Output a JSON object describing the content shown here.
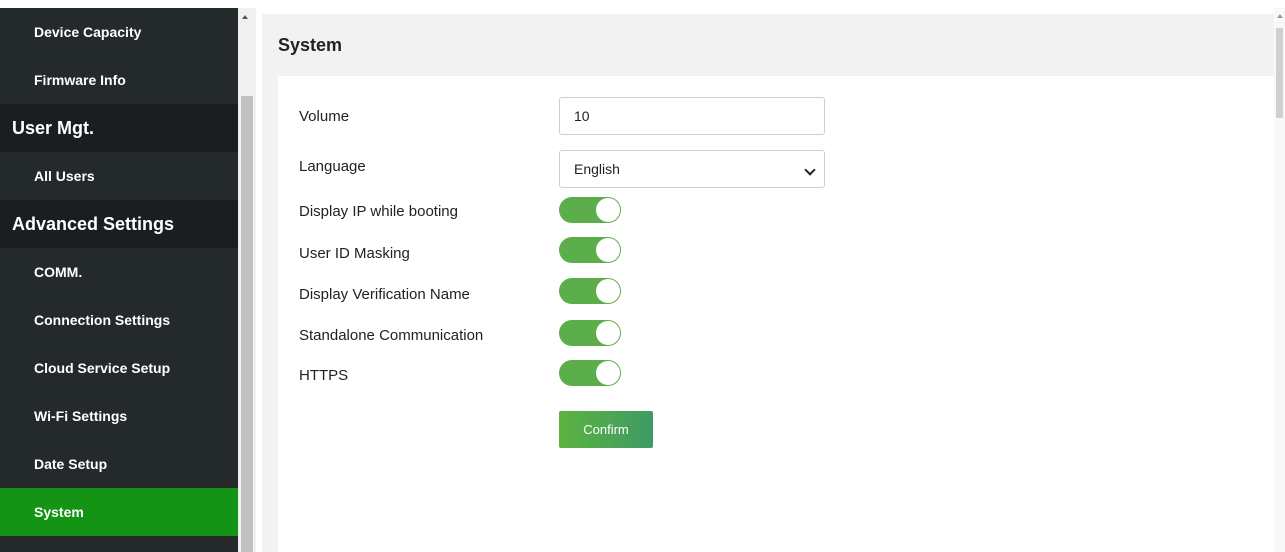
{
  "sidebar": {
    "items": [
      {
        "label": "Device Capacity",
        "type": "item"
      },
      {
        "label": "Firmware Info",
        "type": "item"
      },
      {
        "label": "User Mgt.",
        "type": "group"
      },
      {
        "label": "All Users",
        "type": "item"
      },
      {
        "label": "Advanced Settings",
        "type": "group"
      },
      {
        "label": "COMM.",
        "type": "item"
      },
      {
        "label": "Connection Settings",
        "type": "item"
      },
      {
        "label": "Cloud Service Setup",
        "type": "item"
      },
      {
        "label": "Wi-Fi Settings",
        "type": "item"
      },
      {
        "label": "Date Setup",
        "type": "item"
      },
      {
        "label": "System",
        "type": "item",
        "active": true
      }
    ]
  },
  "main": {
    "title": "System",
    "volume": {
      "label": "Volume",
      "value": "10"
    },
    "language": {
      "label": "Language",
      "value": "English"
    },
    "toggles": [
      {
        "label": "Display IP while booting",
        "on": true
      },
      {
        "label": "User ID Masking",
        "on": true
      },
      {
        "label": "Display Verification Name",
        "on": true
      },
      {
        "label": "Standalone Communication",
        "on": true
      },
      {
        "label": "HTTPS",
        "on": true
      }
    ],
    "confirm_label": "Confirm"
  },
  "colors": {
    "sidebar_bg": "#24292b",
    "active_item": "#149414",
    "toggle_on": "#5cae4a",
    "confirm_button": "#4ea855"
  }
}
